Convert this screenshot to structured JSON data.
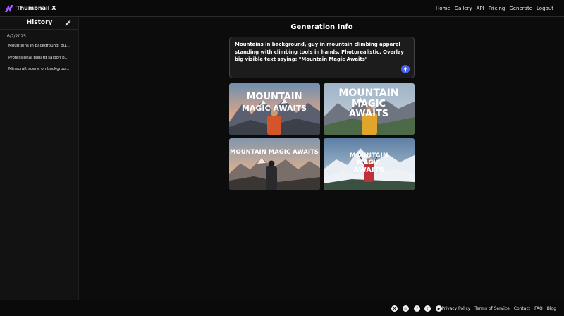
{
  "brand": {
    "name": "Thumbnail X",
    "logo_icon": "lightning-logo-icon",
    "accent": "#a259ff"
  },
  "nav": {
    "items": [
      "Home",
      "Gallery",
      "API",
      "Pricing",
      "Generate",
      "Logout"
    ]
  },
  "sidebar": {
    "title": "History",
    "edit_icon": "pencil-icon",
    "date": "6/7/2025",
    "items": [
      "Mountains in background, guy in mountain climbing apparel standing with climbing tools in hands.",
      "Professional billiard saloon background",
      "Minecraft scene on background"
    ]
  },
  "main": {
    "title": "Generation Info",
    "prompt": "Mountains in background, guy in mountain climbing apparel standing with climbing tools in hands. Photorealistic. Overlay big visible text saying: \"Mountain Magic Awaits\"",
    "send_color": "#4a63ee",
    "thumbnails": [
      {
        "line1": "MOUNTAIN",
        "line2": "MAGIC AWAITS"
      },
      {
        "line1": "MOUNTAIN",
        "line2": "MAGIC",
        "line3": "AWAITS"
      },
      {
        "line1": "MOUNTAIN MAGIC AWAITS"
      },
      {
        "line1": "MOUNTAIN",
        "line2": "MAGIC",
        "line3": "AWAITS"
      }
    ]
  },
  "footer": {
    "social_icons": [
      "x-icon",
      "instagram-icon",
      "facebook-icon",
      "tiktok-icon",
      "youtube-icon"
    ],
    "links": [
      "Privacy Policy",
      "Terms of Service",
      "Contact",
      "FAQ",
      "Blog"
    ]
  }
}
